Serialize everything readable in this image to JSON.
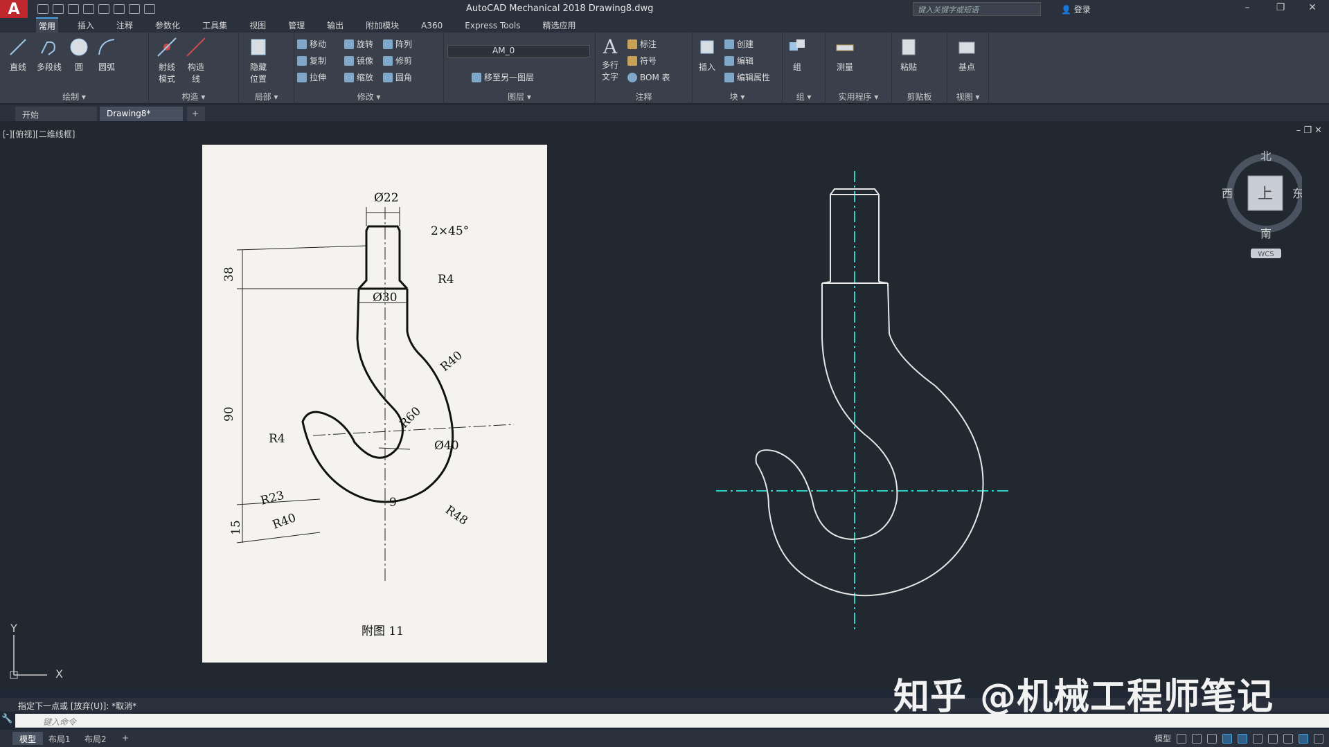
{
  "titlebar": {
    "logo": "A",
    "title": "AutoCAD Mechanical 2018    Drawing8.dwg",
    "search_placeholder": "键入关键字或短语",
    "login": "登录",
    "minimize": "–",
    "restore": "❐",
    "close": "✕"
  },
  "ribbon_tabs": [
    "常用",
    "插入",
    "注释",
    "参数化",
    "工具集",
    "视图",
    "管理",
    "输出",
    "附加模块",
    "A360",
    "Express Tools",
    "精选应用"
  ],
  "ribbon": {
    "draw": {
      "label": "绘制 ▾",
      "line": "直线",
      "polyline": "多段线",
      "circle": "圆",
      "arc": "圆弧"
    },
    "construct": {
      "label": "构造 ▾",
      "ray_mode_1": "射线",
      "ray_mode_2": "模式",
      "construct_line_1": "构造",
      "construct_line_2": "线"
    },
    "detail": {
      "label": "局部 ▾",
      "hide_1": "隐藏",
      "hide_2": "位置"
    },
    "modify": {
      "label": "修改 ▾",
      "move": "移动",
      "rotate": "旋转",
      "array": "阵列",
      "copy": "复制",
      "mirror": "镜像",
      "trim": "修剪",
      "stretch": "拉伸",
      "scale": "缩放",
      "fillet": "圆角"
    },
    "layers": {
      "label": "图层 ▾",
      "current_layer": "AM_0",
      "move_to_layer": "移至另一图层"
    },
    "annotation": {
      "label": "注释",
      "mtext_1": "多行",
      "mtext_2": "文字",
      "dimension": "标注",
      "symbol": "符号",
      "bom": "BOM 表"
    },
    "block": {
      "label": "块 ▾",
      "insert": "插入",
      "create": "创建",
      "edit": "编辑",
      "edit_attr": "编辑属性"
    },
    "group": {
      "label": "组 ▾",
      "group": "组"
    },
    "utilities": {
      "label": "实用程序 ▾",
      "measure": "测量"
    },
    "clipboard": {
      "label": "剪贴板",
      "paste": "粘贴"
    },
    "view": {
      "label": "视图 ▾",
      "base": "基点"
    }
  },
  "doc_tabs": {
    "start": "开始",
    "drawing": "Drawing8*",
    "add": "+"
  },
  "viewport": {
    "label": "[-][俯视][二维线框]",
    "viewcube": {
      "north": "北",
      "south": "南",
      "east": "东",
      "west": "西",
      "top": "上",
      "wcs": "WCS"
    },
    "ucs_x": "X",
    "ucs_y": "Y"
  },
  "reference_drawing": {
    "dim_d22": "Ø22",
    "chamfer": "2×45°",
    "r4_top": "R4",
    "dim_38": "38",
    "dim_d30": "Ø30",
    "r40_right": "R40",
    "dim_90": "90",
    "r60": "R60",
    "dim_d40": "Ø40",
    "r4_left": "R4",
    "r23": "R23",
    "dim_9": "9",
    "r48": "R48",
    "r40_left": "R40",
    "dim_15": "15",
    "caption": "附图 11"
  },
  "command": {
    "history": "指定下一点或 [放弃(U)]: *取消*",
    "placeholder": "键入命令"
  },
  "layout_tabs": [
    "模型",
    "布局1",
    "布局2",
    "+"
  ],
  "status": {
    "model": "模型"
  },
  "watermark": "知乎 @机械工程师笔记",
  "colors": {
    "accent": "#4aa3df",
    "centerline": "#2fd0c8",
    "geometry": "#e6e6e6",
    "logo": "#c0272d"
  }
}
